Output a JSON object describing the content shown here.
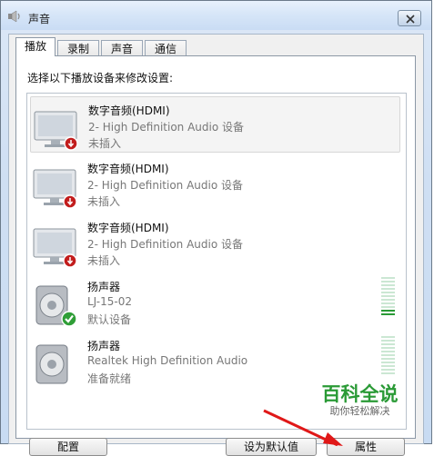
{
  "window": {
    "title": "声音"
  },
  "tabs": [
    {
      "label": "播放"
    },
    {
      "label": "录制"
    },
    {
      "label": "声音"
    },
    {
      "label": "通信"
    }
  ],
  "panel": {
    "instruction": "选择以下播放设备来修改设置:"
  },
  "devices": [
    {
      "name": "数字音频(HDMI)",
      "description": "2- High Definition Audio 设备",
      "status": "未插入",
      "icon": "monitor-icon",
      "badge": "disconnected-badge-icon",
      "selected": true
    },
    {
      "name": "数字音频(HDMI)",
      "description": "2- High Definition Audio 设备",
      "status": "未插入",
      "icon": "monitor-icon",
      "badge": "disconnected-badge-icon",
      "selected": false
    },
    {
      "name": "数字音频(HDMI)",
      "description": "2- High Definition Audio 设备",
      "status": "未插入",
      "icon": "monitor-icon",
      "badge": "disconnected-badge-icon",
      "selected": false
    },
    {
      "name": "扬声器",
      "description": "LJ-15-02",
      "status": "默认设备",
      "icon": "speaker-icon",
      "badge": "default-check-icon",
      "selected": false,
      "meter_level": 0.2
    },
    {
      "name": "扬声器",
      "description": "Realtek High Definition Audio",
      "status": "准备就绪",
      "icon": "speaker-icon",
      "badge": "",
      "selected": false,
      "meter_level": 0
    }
  ],
  "watermark": {
    "main": "百科全说",
    "sub": "助你轻松解决"
  },
  "buttons": [
    {
      "label": "配置"
    },
    {
      "label": "设为默认值"
    },
    {
      "label": "属性"
    }
  ],
  "colors": {
    "accent_green": "#2a9a36",
    "arrow_red": "#e01818"
  }
}
